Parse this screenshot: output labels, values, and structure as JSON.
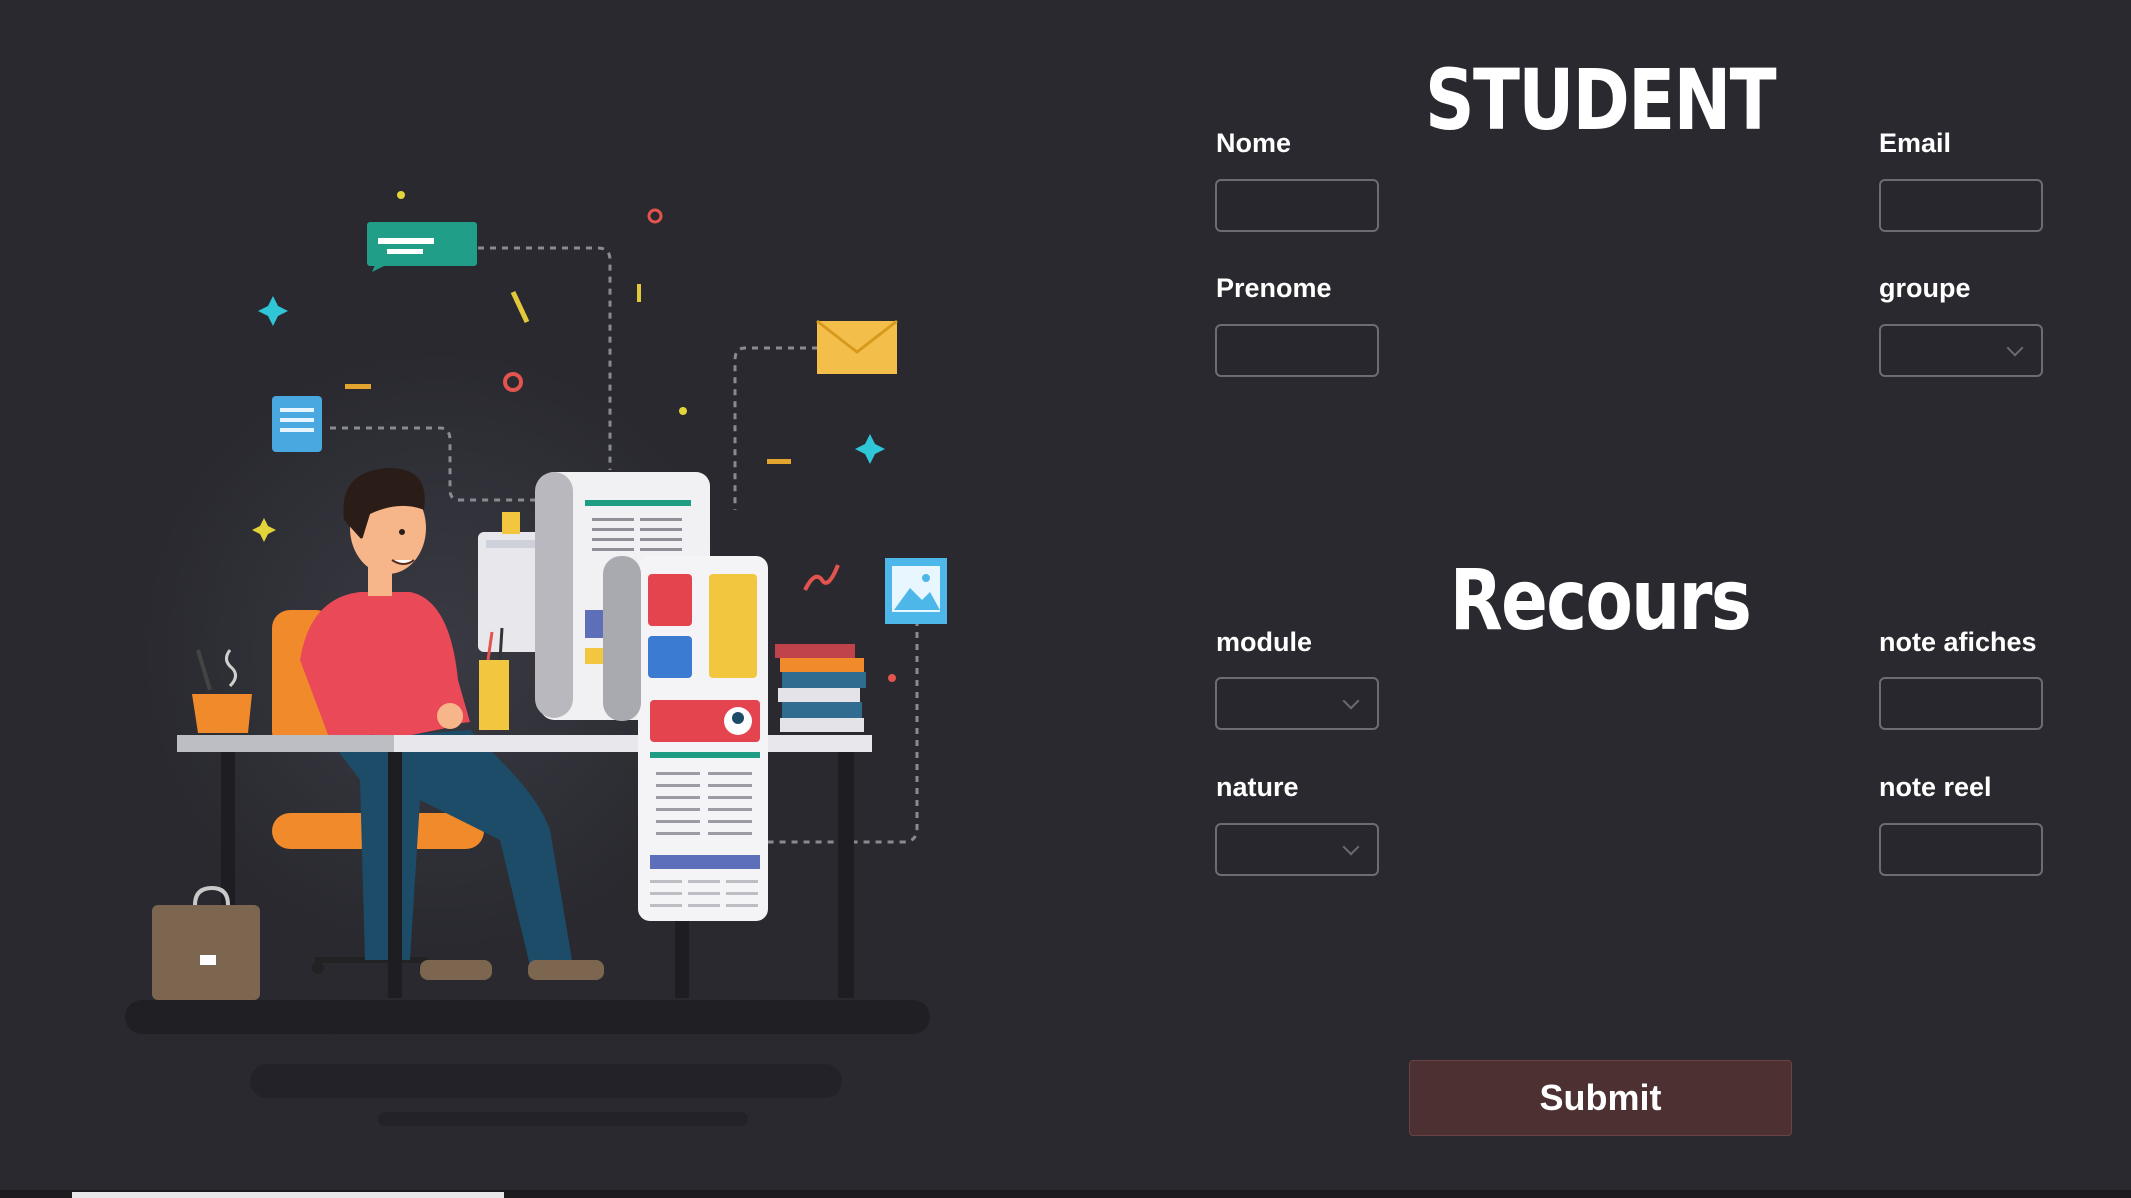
{
  "student": {
    "title": "STUDENT",
    "nom_label": "Nome",
    "email_label": "Email",
    "prenom_label": "Prenome",
    "groupe_label": "groupe"
  },
  "recours": {
    "title": "Recours",
    "module_label": "module",
    "note_affiches_label": "note afiches",
    "nature_label": "nature",
    "note_reel_label": "note reel"
  },
  "submit_label": "Submit",
  "colors": {
    "background": "#29292f",
    "submit": "#4d3031",
    "input_border": "#6c6c74"
  },
  "icons": [
    "chevron-down-icon",
    "envelope-icon",
    "image-icon",
    "chat-icon",
    "sparkle-icon"
  ]
}
